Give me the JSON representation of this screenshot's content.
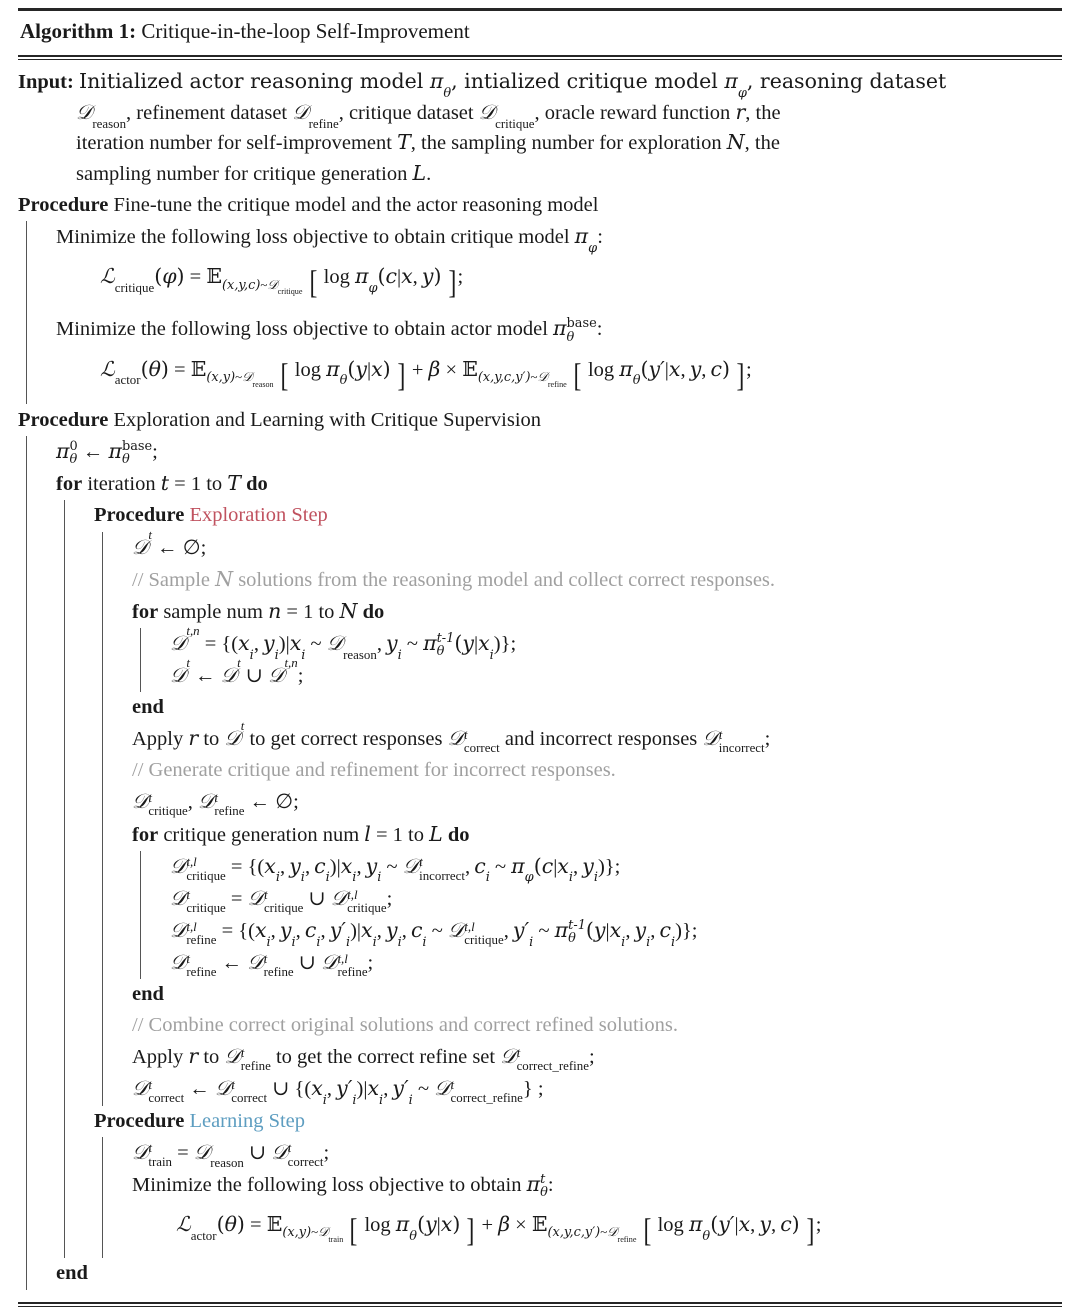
{
  "header": {
    "label": "Algorithm 1:",
    "title": "Critique-in-the-loop Self-Improvement"
  },
  "input": {
    "label": "Input:",
    "lines": [
      "Initialized actor reasoning model πθ, intialized critique model πϕ, reasoning dataset",
      "𝒟reason, refinement dataset 𝒟refine, critique dataset 𝒟critique, oracle reward function r, the",
      "iteration number for self-improvement T, the sampling number for exploration N, the",
      "sampling number for critique generation L."
    ]
  },
  "procedures": {
    "finetune": {
      "keyword": "Procedure",
      "title": "Fine-tune the critique model and the actor reasoning model",
      "step1_text": "Minimize the following loss objective to obtain critique model πϕ:",
      "step2_text": "Minimize the following loss objective to obtain actor model πθbase:"
    },
    "exploration": {
      "keyword": "Procedure",
      "title": "Exploration and Learning with Critique Supervision"
    },
    "exploration_step": {
      "keyword": "Procedure",
      "title": "Exploration Step",
      "color": "#c0525f"
    },
    "learning_step": {
      "keyword": "Procedure",
      "title": "Learning Step",
      "color": "#5d9dc0"
    }
  },
  "keywords": {
    "for": "for",
    "to": "to",
    "do": "do",
    "end": "end",
    "apply": "Apply",
    "minimize": "Minimize"
  },
  "loops": {
    "iteration": {
      "text": "iteration",
      "var": "t",
      "from": "1",
      "to": "T"
    },
    "sample": {
      "text": "sample num",
      "var": "n",
      "from": "1",
      "to": "N"
    },
    "critique": {
      "text": "critique generation num",
      "var": "l",
      "from": "1",
      "to": "L"
    }
  },
  "comments": {
    "sample": "// Sample N solutions from the reasoning model and collect correct responses.",
    "generate": "// Generate critique and refinement for incorrect responses.",
    "combine": "// Combine correct original solutions and correct refined solutions."
  },
  "statements": {
    "apply_r_correct": "Apply r to 𝒟t to get correct responses 𝒟tcorrect and incorrect responses 𝒟tincorrect;",
    "apply_r_refine": "Apply r to 𝒟trefine to get the correct refine set 𝒟tcorrect_refine;",
    "minimize_final": "Minimize the following loss objective to obtain πθt:"
  },
  "equations": {
    "critique_loss": "ℒcritique(ϕ) = 𝔼(x,y,c)~𝒟critique [ log πϕ(c|x,y) ];",
    "actor_loss_base": "ℒactor(θ) = 𝔼(x,y)~𝒟reason [ log πθ(y|x) ] + β × 𝔼(x,y,c,y')~𝒟refine [ log πθ(y'|x,y,c) ];",
    "pi_init": "πθ0 ← πθbase;",
    "dt_empty": "𝒟t ← ∅;",
    "dtn_def": "𝒟t,n = {(xi,yi)|xi ~ 𝒟reason, yi ~ πθt-1(y|xi)};",
    "dt_union": "𝒟t ← 𝒟t ∪ 𝒟t,n;",
    "dcrit_empty": "𝒟tcritique, 𝒟trefine ← ∅;",
    "dtl_critique": "𝒟t,lcritique = {(xi,yi,ci)|xi,yi ~ 𝒟tincorrect, ci ~ πϕ(c|xi,yi)};",
    "dt_critique_union": "𝒟tcritique = 𝒟tcritique ∪ 𝒟t,lcritique;",
    "dtl_refine": "𝒟t,lrefine = {(xi,yi,ci,y'i)|xi,yi,ci ~ 𝒟t,lcritique, y'i ~ πθt-1(y|xi,yi,ci)};",
    "dt_refine_union": "𝒟trefine ← 𝒟trefine ∪ 𝒟t,lrefine;",
    "dt_correct_union": "𝒟tcorrect ← 𝒟tcorrect ∪ {(xi,y'i)|xi,y'i ~ 𝒟tcorrect_refine} ;",
    "dt_train": "𝒟ttrain = 𝒟reason ∪ 𝒟tcorrect;",
    "actor_loss_final": "ℒactor(θ) = 𝔼(x,y)~𝒟train [ log πθ(y|x) ] + β × 𝔼(x,y,c,y')~𝒟refine [ log πθ(y'|x,y,c) ];"
  }
}
